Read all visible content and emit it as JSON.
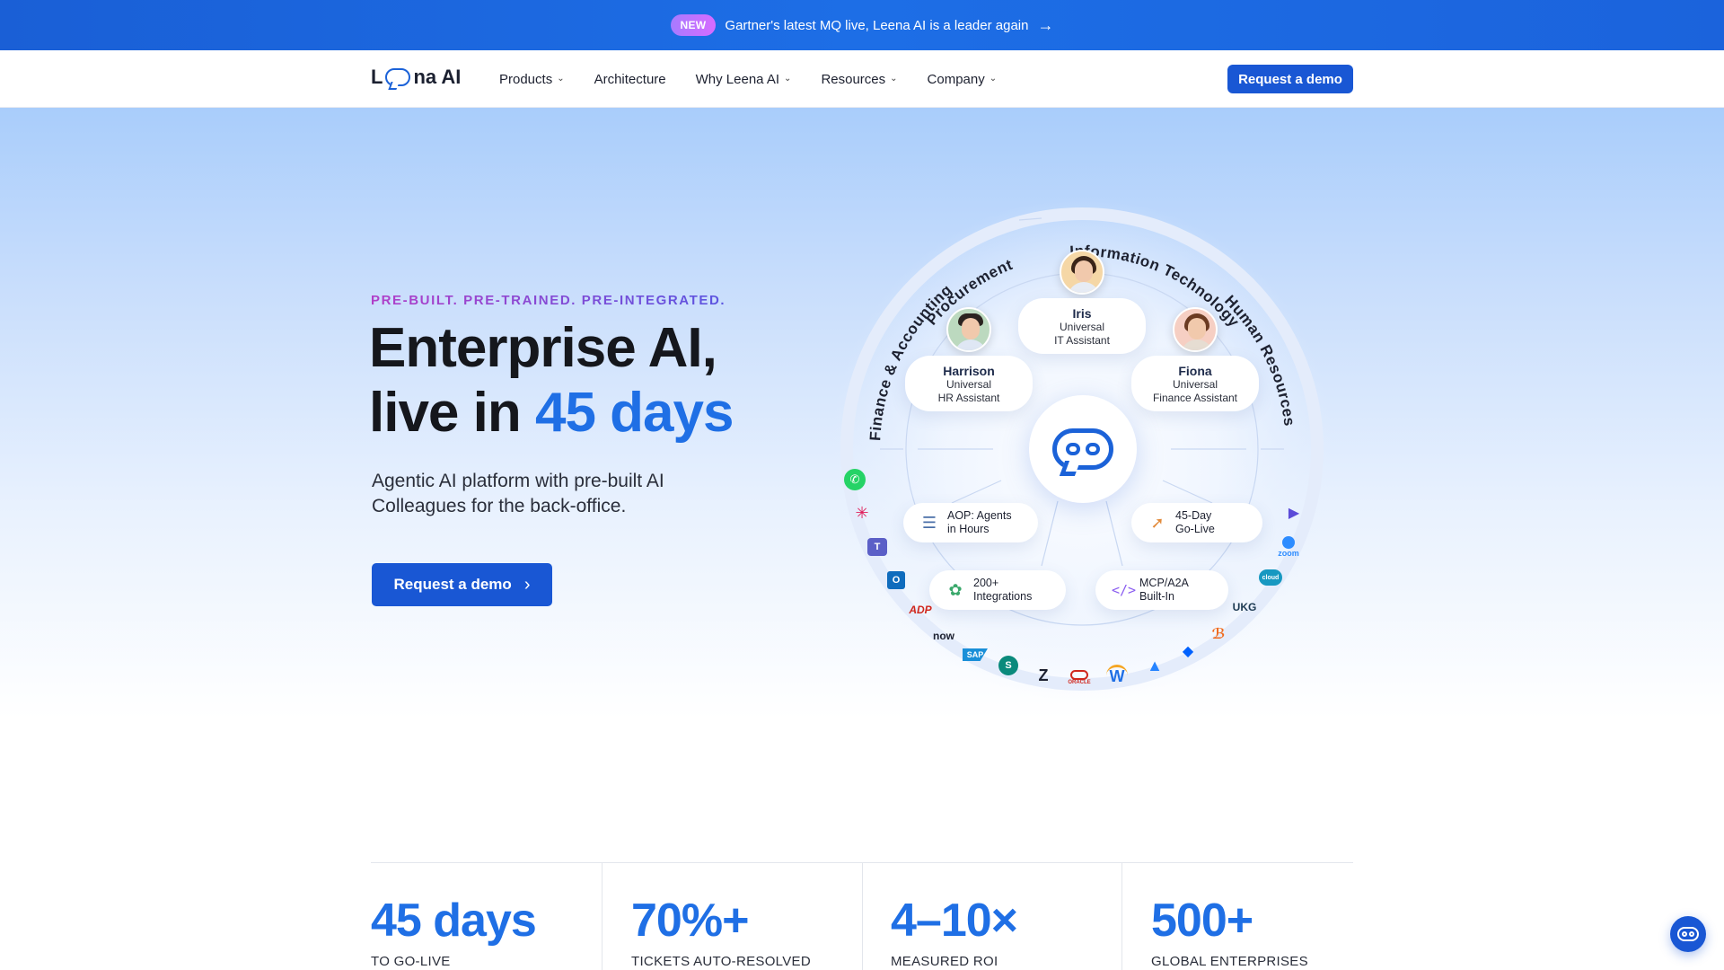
{
  "announcement": {
    "badge": "NEW",
    "message": "Gartner's latest MQ live, Leena AI is a leader again"
  },
  "nav": {
    "logo_text_pre": "L",
    "logo_text_post": "na AI",
    "items": [
      {
        "label": "Products",
        "dropdown": true
      },
      {
        "label": "Architecture",
        "dropdown": false
      },
      {
        "label": "Why Leena AI",
        "dropdown": true
      },
      {
        "label": "Resources",
        "dropdown": true
      },
      {
        "label": "Company",
        "dropdown": true
      }
    ],
    "cta": "Request a demo"
  },
  "hero": {
    "eyebrow": "PRE-BUILT. PRE-TRAINED. PRE-INTEGRATED.",
    "title_line1": "Enterprise AI,",
    "title_line2_pre": "live in ",
    "title_line2_accent": "45 days",
    "subtitle": "Agentic AI platform with pre-built AI Colleagues for the back-office.",
    "cta": "Request a demo"
  },
  "diagram": {
    "arc_labels": {
      "procurement": "Procurement",
      "it": "Information Technology",
      "finance": "Finance & Accounting",
      "hr": "Human Resources"
    },
    "assistants": [
      {
        "name": "Iris",
        "role_line1": "Universal",
        "role_line2": "IT Assistant"
      },
      {
        "name": "Harrison",
        "role_line1": "Universal",
        "role_line2": "HR Assistant"
      },
      {
        "name": "Fiona",
        "role_line1": "Universal",
        "role_line2": "Finance Assistant"
      }
    ],
    "features": [
      {
        "line1": "AOP: Agents",
        "line2": "in Hours"
      },
      {
        "line1": "45-Day",
        "line2": "Go-Live"
      },
      {
        "line1": "200+",
        "line2": "Integrations"
      },
      {
        "line1": "MCP/A2A",
        "line2": "Built-In"
      }
    ],
    "integration_labels": {
      "zoom": "zoom",
      "ukg": "UKG",
      "now": "now",
      "sap": "SAP",
      "adp": "ADP",
      "oracle": "ORACLE",
      "workday": "W"
    },
    "colors": {
      "accent": "#1f6fe5",
      "cta": "#1957d4"
    }
  },
  "stats": [
    {
      "value": "45 days",
      "label": "TO GO-LIVE"
    },
    {
      "value": "70%+",
      "label": "TICKETS AUTO-RESOLVED"
    },
    {
      "value": "4–10×",
      "label": "MEASURED ROI"
    },
    {
      "value": "500+",
      "label": "GLOBAL ENTERPRISES"
    }
  ]
}
